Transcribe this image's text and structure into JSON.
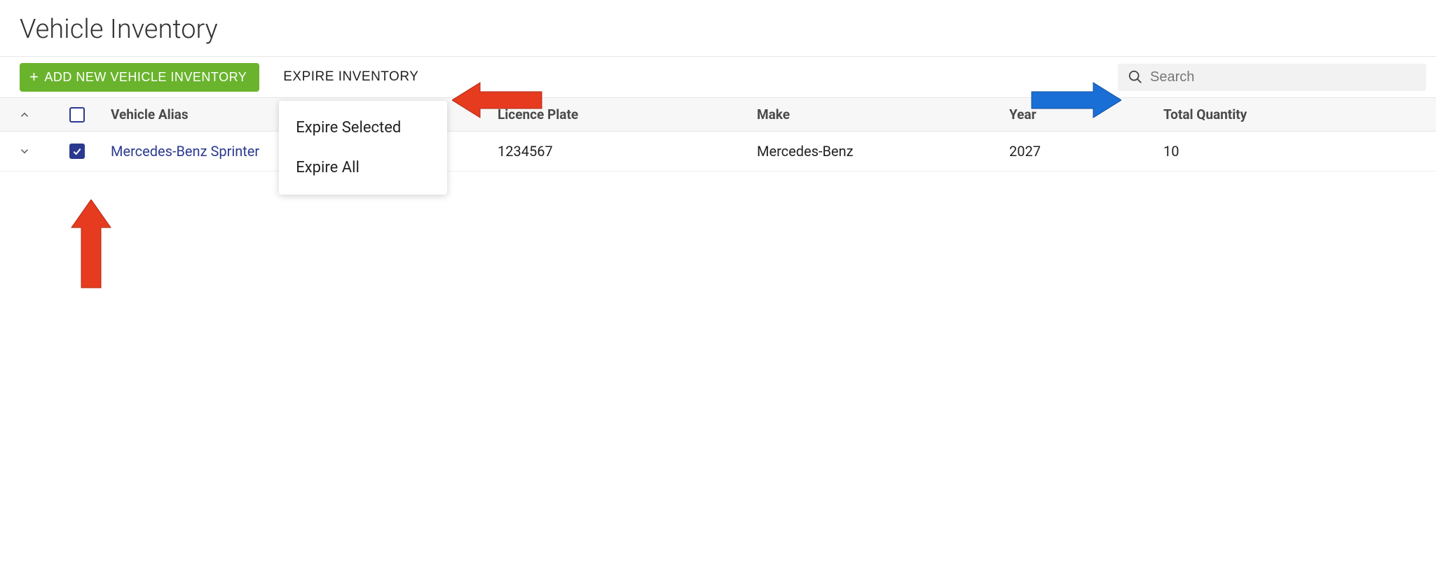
{
  "page": {
    "title": "Vehicle Inventory"
  },
  "toolbar": {
    "add_label": "ADD NEW VEHICLE INVENTORY",
    "expire_label": "EXPIRE INVENTORY",
    "dropdown": {
      "expire_selected": "Expire Selected",
      "expire_all": "Expire All"
    }
  },
  "search": {
    "placeholder": "Search",
    "value": ""
  },
  "table": {
    "headers": {
      "alias": "Vehicle Alias",
      "plate": "Licence Plate",
      "make": "Make",
      "year": "Year",
      "qty": "Total Quantity"
    },
    "rows": [
      {
        "checked": true,
        "alias": "Mercedes-Benz Sprinter",
        "plate": "1234567",
        "make": "Mercedes-Benz",
        "year": "2027",
        "qty": "10"
      }
    ]
  }
}
